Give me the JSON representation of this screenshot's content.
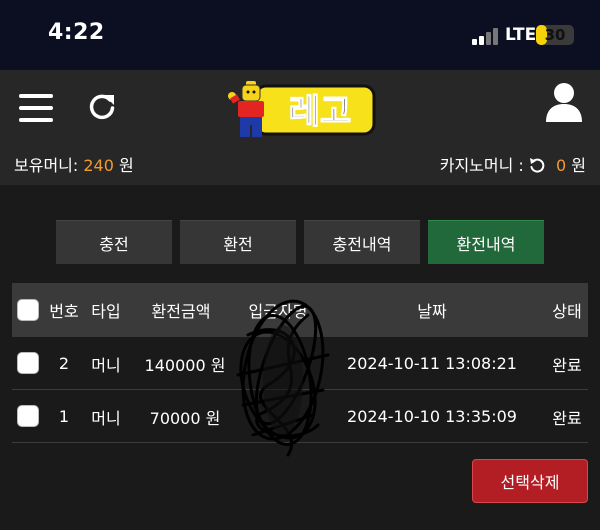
{
  "status_bar": {
    "time": "4:22",
    "network": "LTE",
    "battery": "30",
    "battery_level": 0.3
  },
  "header": {
    "logo_text": "레고",
    "balance_label": "보유머니:",
    "balance_value": "240",
    "balance_unit": "원",
    "casino_label": "카지노머니 :",
    "casino_value": "0",
    "casino_unit": "원"
  },
  "tabs": [
    {
      "label": "충전",
      "active": false
    },
    {
      "label": "환전",
      "active": false
    },
    {
      "label": "충전내역",
      "active": false
    },
    {
      "label": "환전내역",
      "active": true
    }
  ],
  "table": {
    "headers": {
      "no": "번호",
      "type": "타입",
      "amount": "환전금액",
      "depositor": "입금자명",
      "date": "날짜",
      "status": "상태"
    },
    "rows": [
      {
        "no": "2",
        "type": "머니",
        "amount": "140000 원",
        "depositor": "",
        "date": "2024-10-11 13:08:21",
        "status": "완료"
      },
      {
        "no": "1",
        "type": "머니",
        "amount": "70000 원",
        "depositor": "",
        "date": "2024-10-10 13:35:09",
        "status": "완료"
      }
    ]
  },
  "actions": {
    "delete_selected": "선택삭제"
  },
  "colors": {
    "accent_green": "#21683b",
    "accent_orange": "#f39a2e",
    "danger_red": "#b31d24",
    "logo_yellow": "#f6e11a"
  }
}
